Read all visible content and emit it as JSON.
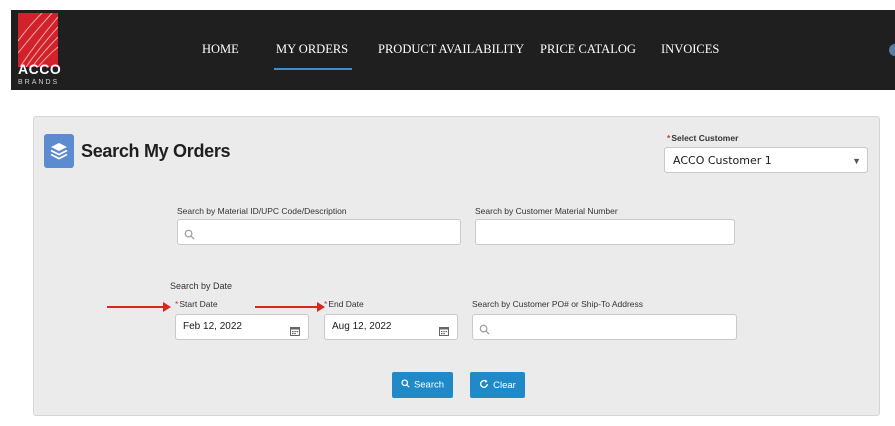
{
  "brand": {
    "name": "ACCO",
    "sub": "BRANDS"
  },
  "nav": {
    "items": [
      {
        "label": "HOME"
      },
      {
        "label": "MY ORDERS",
        "active": true
      },
      {
        "label": "PRODUCT AVAILABILITY"
      },
      {
        "label": "PRICE CATALOG"
      },
      {
        "label": "INVOICES"
      }
    ]
  },
  "page": {
    "title": "Search My Orders"
  },
  "customer": {
    "label": "Select Customer",
    "required": "*",
    "value": "ACCO Customer 1"
  },
  "filters": {
    "material_label": "Search by Material ID/UPC Code/Description",
    "customer_material_label": "Search by Customer Material Number",
    "date_section_label": "Search by Date",
    "start_date_label": "Start Date",
    "start_date_value": "Feb 12, 2022",
    "end_date_label": "End Date",
    "end_date_value": "Aug 12, 2022",
    "po_label": "Search by Customer PO# or Ship-To Address",
    "required": "*"
  },
  "buttons": {
    "search": "Search",
    "clear": "Clear"
  },
  "colors": {
    "accent": "#1f8ac7",
    "header_bg": "#1f1f1f",
    "brand_red": "#d1222b",
    "annotation_arrow": "#d9271e"
  },
  "icons": [
    "stack-icon",
    "search-icon",
    "calendar-icon",
    "refresh-icon",
    "chevron-down-icon"
  ]
}
